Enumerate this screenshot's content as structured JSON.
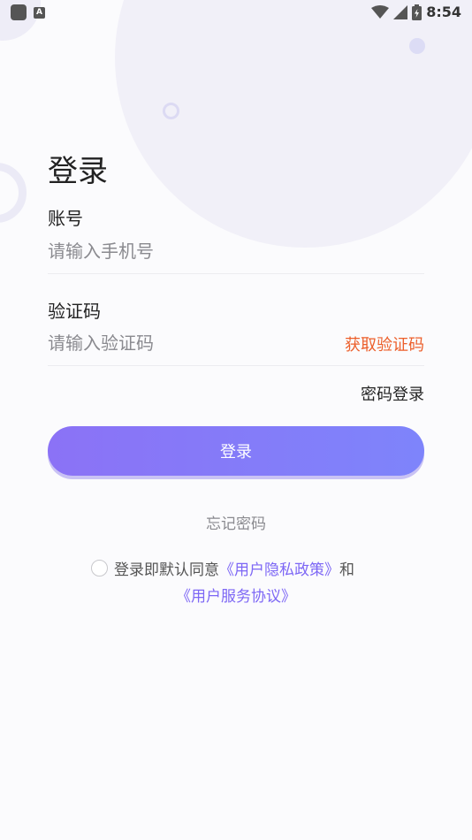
{
  "status_bar": {
    "time": "8:54",
    "app_badge": "A"
  },
  "login": {
    "title": "登录",
    "account_label": "账号",
    "phone_placeholder": "请输入手机号",
    "code_label": "验证码",
    "code_placeholder": "请输入验证码",
    "get_code": "获取验证码",
    "password_login": "密码登录",
    "login_button": "登录",
    "forgot_password": "忘记密码",
    "agreement_prefix": "登录即默认同意",
    "privacy_policy": "《用户隐私政策》",
    "agreement_and": "和",
    "service_agreement": "《用户服务协议》"
  },
  "colors": {
    "accent": "#7d67f5",
    "button_gradient_start": "#8b72f6",
    "button_gradient_end": "#7e84fb",
    "get_code": "#ec5f2b"
  }
}
